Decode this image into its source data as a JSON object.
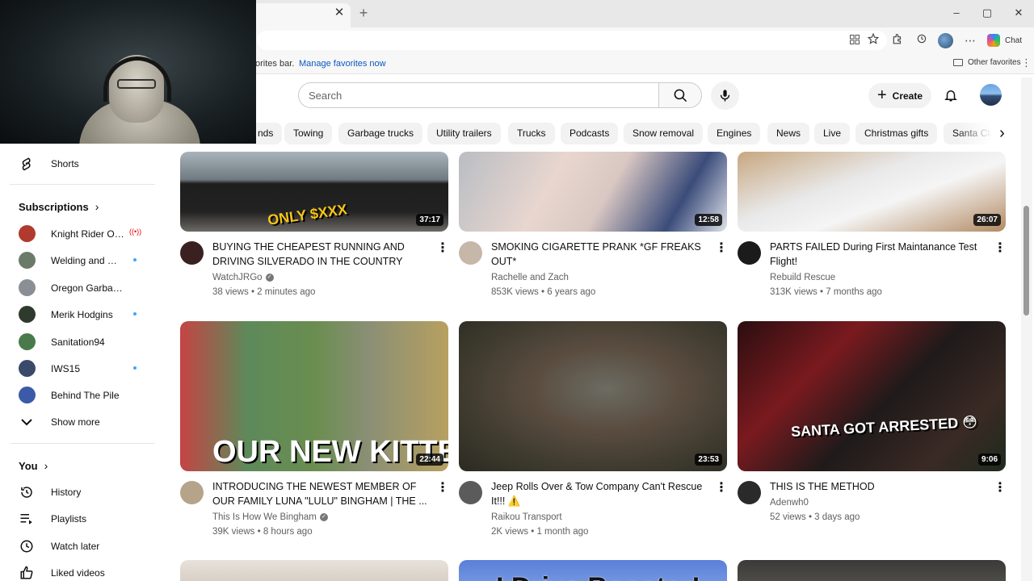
{
  "browser": {
    "tab_close": "✕",
    "tab_new": "+",
    "window_buttons": {
      "minimize": "–",
      "maximize": "▢",
      "close": "✕"
    },
    "favorites_bar_text": "orites bar.",
    "favorites_link": "Manage favorites now",
    "other_favorites": "Other favorites",
    "chat_label": "Chat"
  },
  "header": {
    "search_placeholder": "Search",
    "create_label": "Create"
  },
  "chips": [
    "nds",
    "Towing",
    "Garbage trucks",
    "Utility trailers",
    "Trucks",
    "Podcasts",
    "Snow removal",
    "Engines",
    "News",
    "Live",
    "Christmas gifts",
    "Santa Cla"
  ],
  "sidebar": {
    "shorts_label": "Shorts",
    "subscriptions_heading": "Subscriptions",
    "subscriptions": [
      {
        "name": "Knight Rider Offi...",
        "indicator": "live",
        "color": "#b03a2e"
      },
      {
        "name": "Welding and Wh...",
        "indicator": "dot",
        "color": "#6b7b6a"
      },
      {
        "name": "Oregon Garbage & ...",
        "indicator": "none",
        "color": "#8a8f96"
      },
      {
        "name": "Merik Hodgins",
        "indicator": "dot",
        "color": "#2f3a2e"
      },
      {
        "name": "Sanitation94",
        "indicator": "none",
        "color": "#4a7a4a"
      },
      {
        "name": "IWS15",
        "indicator": "dot",
        "color": "#3a4a6a"
      },
      {
        "name": "Behind The Pile",
        "indicator": "none",
        "color": "#3b5aa8"
      }
    ],
    "show_more_label": "Show more",
    "you_heading": "You",
    "you_items": [
      {
        "label": "History",
        "icon": "history-icon"
      },
      {
        "label": "Playlists",
        "icon": "playlists-icon"
      },
      {
        "label": "Watch later",
        "icon": "watch-later-icon"
      },
      {
        "label": "Liked videos",
        "icon": "liked-videos-icon"
      }
    ]
  },
  "videos": [
    {
      "title": "BUYING THE CHEAPEST RUNNING AND DRIVING SILVERADO IN THE COUNTRY",
      "channel": "WatchJRGo",
      "verified": true,
      "views": "38 views",
      "age": "2 minutes ago",
      "duration": "37:17",
      "thumb_text": "ONLY $XXX"
    },
    {
      "title": "SMOKING CIGARETTE PRANK *GF FREAKS OUT*",
      "channel": "Rachelle and Zach",
      "verified": false,
      "views": "853K views",
      "age": "6 years ago",
      "duration": "12:58",
      "thumb_text": ""
    },
    {
      "title": "PARTS FAILED During First Maintanance Test Flight!",
      "channel": "Rebuild Rescue",
      "verified": false,
      "views": "313K views",
      "age": "7 months ago",
      "duration": "26:07",
      "thumb_text": ""
    },
    {
      "title": "INTRODUCING THE NEWEST MEMBER OF OUR FAMILY LUNA \"LULU\" BINGHAM | THE ...",
      "channel": "This Is How We Bingham",
      "verified": true,
      "views": "39K views",
      "age": "8 hours ago",
      "duration": "22:44",
      "thumb_text": "OUR NEW KITTEN"
    },
    {
      "title": "Jeep Rolls Over & Tow Company Can't Rescue It!!! ⚠️",
      "channel": "Raikou Transport",
      "verified": false,
      "views": "2K views",
      "age": "1 month ago",
      "duration": "23:53",
      "thumb_text": ""
    },
    {
      "title": "THIS IS THE METHOD",
      "channel": "Adenwh0",
      "verified": false,
      "views": "52 views",
      "age": "3 days ago",
      "duration": "9:06",
      "thumb_text": "SANTA GOT ARRESTED 😳"
    },
    {
      "title": "",
      "channel": "",
      "verified": false,
      "views": "",
      "age": "",
      "duration": "",
      "thumb_text": ""
    },
    {
      "title": "",
      "channel": "",
      "verified": false,
      "views": "",
      "age": "",
      "duration": "",
      "thumb_text": "I Drive Booster!"
    },
    {
      "title": "",
      "channel": "",
      "verified": false,
      "views": "",
      "age": "",
      "duration": "",
      "thumb_text": ""
    }
  ],
  "meta_separator": " • "
}
